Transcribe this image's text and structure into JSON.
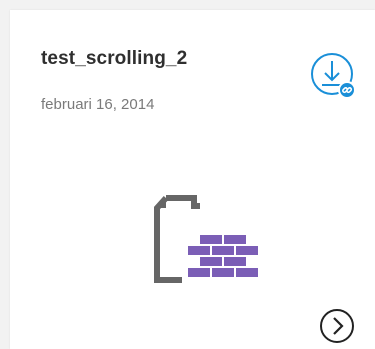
{
  "card": {
    "title": "test_scrolling_2",
    "date": "februari 16, 2014"
  },
  "icons": {
    "download": "download-link-icon",
    "asset": "shared-asset-file-icon",
    "open": "chevron-right-circle-icon"
  },
  "colors": {
    "accent": "#1a8fd8",
    "asset_purple": "#7b5eb6",
    "asset_gray": "#666666"
  }
}
